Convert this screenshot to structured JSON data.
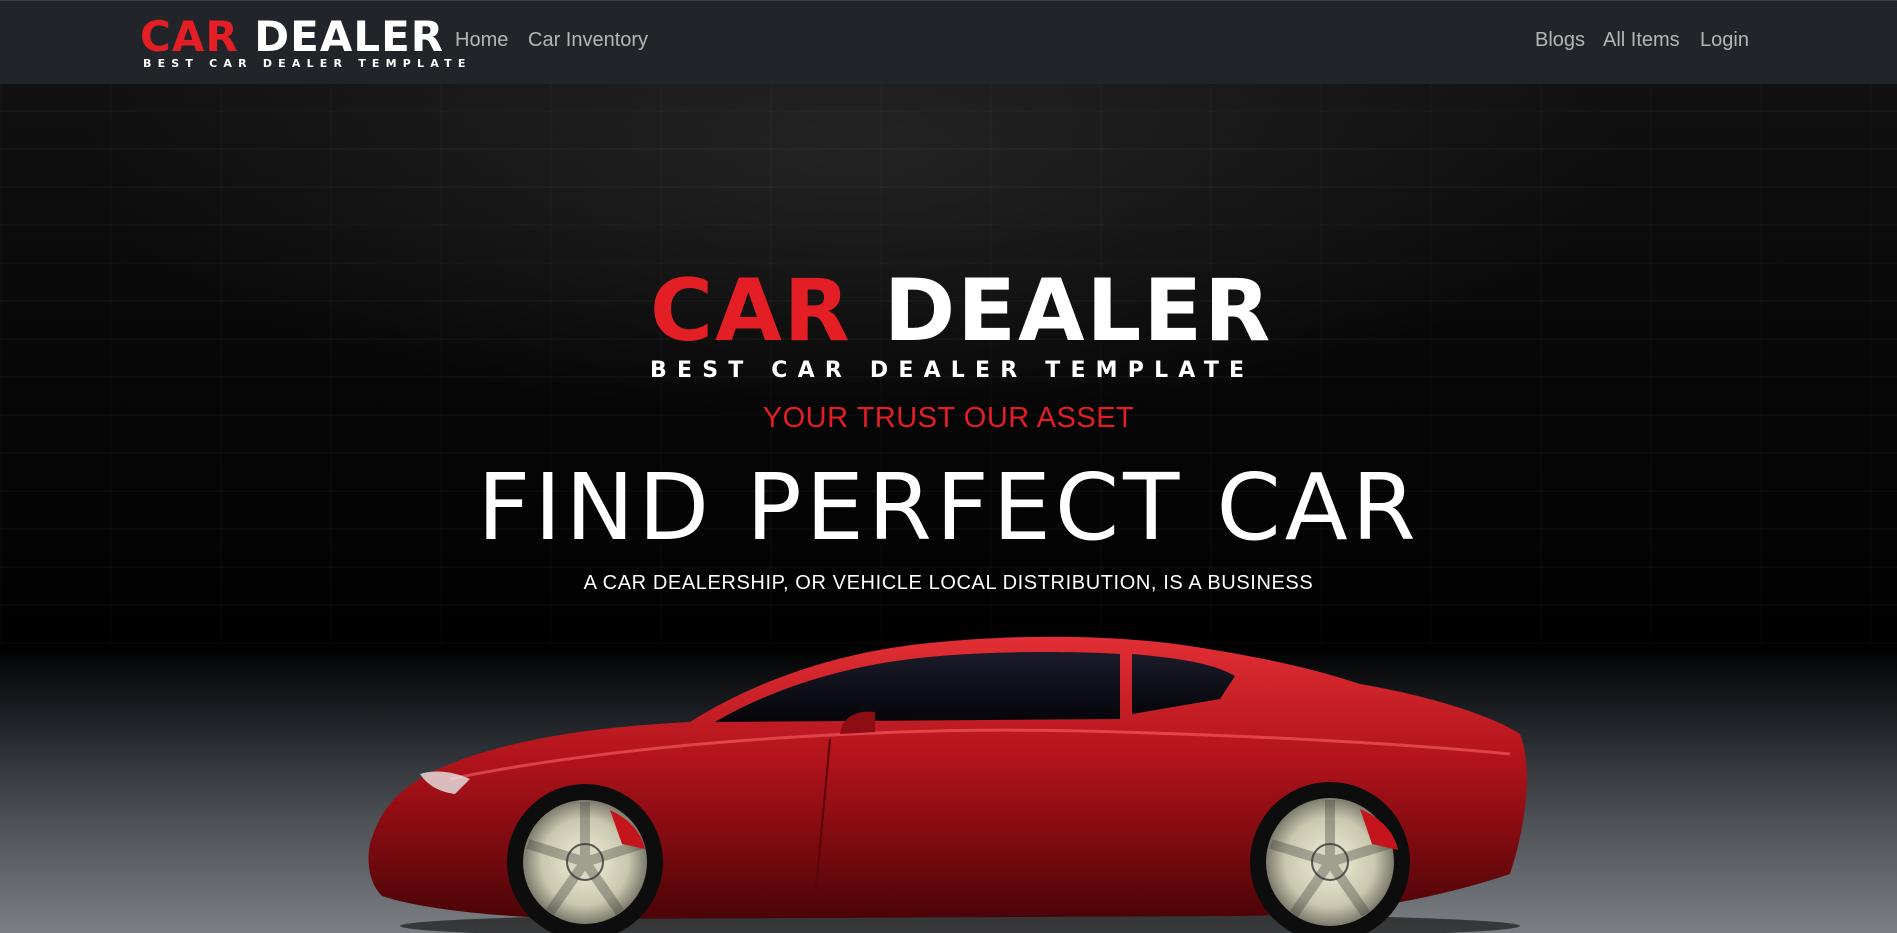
{
  "navbar": {
    "brand": {
      "word1": "CAR",
      "word2": "DEALER",
      "subtitle": "BEST CAR DEALER TEMPLATE"
    },
    "left_links": [
      "Home",
      "Car Inventory"
    ],
    "right_links": [
      "Blogs",
      "All Items",
      "Login"
    ]
  },
  "hero": {
    "logo": {
      "word1": "CAR",
      "word2": "DEALER",
      "subtitle": "BEST CAR DEALER TEMPLATE"
    },
    "tagline": "YOUR TRUST OUR ASSET",
    "headline": "FIND PERFECT CAR",
    "subline": "A CAR DEALERSHIP, OR VEHICLE LOCAL DISTRIBUTION, IS A BUSINESS"
  },
  "colors": {
    "accent": "#e31e24",
    "navbar_bg": "#212529",
    "nav_link": "#a6a8aa"
  }
}
